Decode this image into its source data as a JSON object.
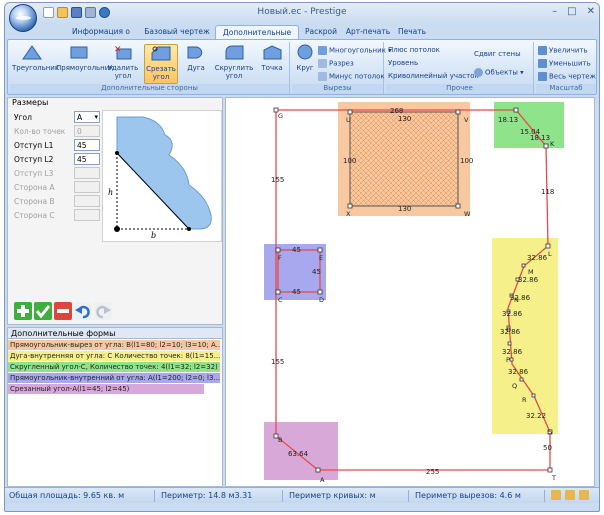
{
  "window": {
    "title": "Новый.ec - Prestige",
    "controls": {
      "minimize": "–",
      "maximize": "□",
      "close": "✕"
    }
  },
  "ribbon": {
    "tabs": [
      {
        "label": "Информация о заказе",
        "active": false
      },
      {
        "label": "Базовый чертеж",
        "active": false
      },
      {
        "label": "Дополнительные формы",
        "active": true
      },
      {
        "label": "Раскрой",
        "active": false
      },
      {
        "label": "Арт-печать",
        "active": false
      },
      {
        "label": "Печать",
        "active": false
      }
    ],
    "groups": {
      "sides": {
        "caption": "Дополнительные стороны",
        "buttons": [
          {
            "label": "Треугольник",
            "icon": "triangle-icon"
          },
          {
            "label": "Прямоугольник",
            "icon": "rectangle-icon"
          },
          {
            "label": "Удалить угол",
            "icon": "delete-corner-icon"
          },
          {
            "label": "Срезать угол",
            "icon": "cut-corner-icon",
            "selected": true
          },
          {
            "label": "Дуга",
            "icon": "arc-icon"
          },
          {
            "label": "Скруглить угол",
            "icon": "round-corner-icon"
          },
          {
            "label": "Точка",
            "icon": "point-icon"
          }
        ]
      },
      "cutouts": {
        "caption": "Вырезы",
        "big": {
          "label": "Круг",
          "icon": "circle-icon"
        },
        "small": [
          {
            "label": "Многоугольник",
            "icon": "polygon-icon"
          },
          {
            "label": "Разрез",
            "icon": "slit-icon"
          },
          {
            "label": "Минус потолок",
            "icon": "minus-ceiling-icon"
          }
        ]
      },
      "other": {
        "caption": "Прочее",
        "items": [
          {
            "label": "Плюс потолок",
            "icon": "plus-ceiling-icon"
          },
          {
            "label": "Уровень",
            "icon": "level-icon"
          },
          {
            "label": "Криволинейный участок",
            "icon": "curve-icon"
          },
          {
            "label": "Сдвиг стены",
            "icon": "wall-shift-icon"
          },
          {
            "label": "Объекты",
            "icon": "objects-icon"
          }
        ]
      },
      "scale": {
        "caption": "Масштаб",
        "items": [
          {
            "label": "Увеличить",
            "icon": "zoom-in-icon"
          },
          {
            "label": "Уменьшить",
            "icon": "zoom-out-icon"
          },
          {
            "label": "Весь чертеж",
            "icon": "fit-drawing-icon"
          }
        ]
      }
    }
  },
  "sizes_panel": {
    "title": "Размеры",
    "fields": [
      {
        "label": "Угол",
        "value": "A",
        "enabled": true,
        "type": "select"
      },
      {
        "label": "Кол-во точек",
        "value": "0",
        "enabled": false,
        "type": "spin"
      },
      {
        "label": "Отступ L1",
        "value": "45",
        "enabled": true,
        "type": "text"
      },
      {
        "label": "Отступ L2",
        "value": "45",
        "enabled": true,
        "type": "text"
      },
      {
        "label": "Отступ L3",
        "value": "",
        "enabled": false,
        "type": "text"
      },
      {
        "label": "Сторона A",
        "value": "",
        "enabled": false,
        "type": "text"
      },
      {
        "label": "Сторона B",
        "value": "",
        "enabled": false,
        "type": "text"
      },
      {
        "label": "Сторона C",
        "value": "",
        "enabled": false,
        "type": "text"
      }
    ],
    "preview_labels": {
      "h": "h",
      "b": "b"
    },
    "toolbar": [
      {
        "name": "add-button",
        "icon": "plus-icon",
        "color": "#3fae3f"
      },
      {
        "name": "apply-button",
        "icon": "check-icon",
        "color": "#3fae3f"
      },
      {
        "name": "remove-button",
        "icon": "minus-icon",
        "color": "#d9483b"
      },
      {
        "name": "undo-button",
        "icon": "undo-icon",
        "color": "#2f6fc9"
      },
      {
        "name": "redo-button",
        "icon": "redo-icon",
        "color": "#b9c3cf"
      }
    ]
  },
  "extra_forms": {
    "title": "Дополнительные формы",
    "items": [
      {
        "text": "Прямоугольник-вырез от угла: B(l1=80; l2=10; l3=10; A...",
        "color": "#f8c9a0"
      },
      {
        "text": "Дуга-внутренняя от угла: C Количество точек: 8(l1=15...",
        "color": "#f5f08a"
      },
      {
        "text": "Скругленный угол-C, Количество точек: 4(l1=32; l2=32)",
        "color": "#8fe38a"
      },
      {
        "text": "Прямоугольник-внутренний от угла: A(l1=200; l2=0; l3...",
        "color": "#a8a8ee"
      },
      {
        "text": "Срезанный угол-A(l1=45; l2=45)",
        "color": "#d8a8d8"
      }
    ]
  },
  "drawing": {
    "dimensions": {
      "top": "268",
      "rect_top": "130",
      "rect_bottom": "130",
      "rect_left": "100",
      "rect_right": "100",
      "left_upper": "155",
      "left_lower": "155",
      "right_upper": "118",
      "inner_top": "45",
      "inner_right": "45",
      "inner_bottom": "45",
      "bottom": "255",
      "cut": "63.64",
      "right_lower": "50",
      "corner_a": "18.13",
      "corner_b": "15.04",
      "corner_c": "18.13",
      "arc_1": "32.86",
      "arc_2": "32.86",
      "arc_3": "32.86",
      "arc_4": "32.86",
      "arc_5": "32.86",
      "arc_6": "32.86",
      "arc_7": "32.86",
      "arc_8": "32.22"
    },
    "points": {
      "G": "G",
      "U": "U",
      "V": "V",
      "X": "X",
      "W": "W",
      "K": "K",
      "L": "L",
      "M": "M",
      "N": "N",
      "O": "O",
      "P": "P",
      "Q": "Q",
      "R": "R",
      "S": "S",
      "T": "T",
      "A": "A",
      "B": "B",
      "F": "F",
      "E": "E",
      "C": "C",
      "D": "D"
    }
  },
  "status": {
    "area": "Общая площадь: 9.65 кв. м",
    "perimeter": "Периметр: 14.8 м3.31",
    "curves": "Периметр кривых:  м",
    "cutouts": "Периметр вырезов: 4.6 м"
  }
}
